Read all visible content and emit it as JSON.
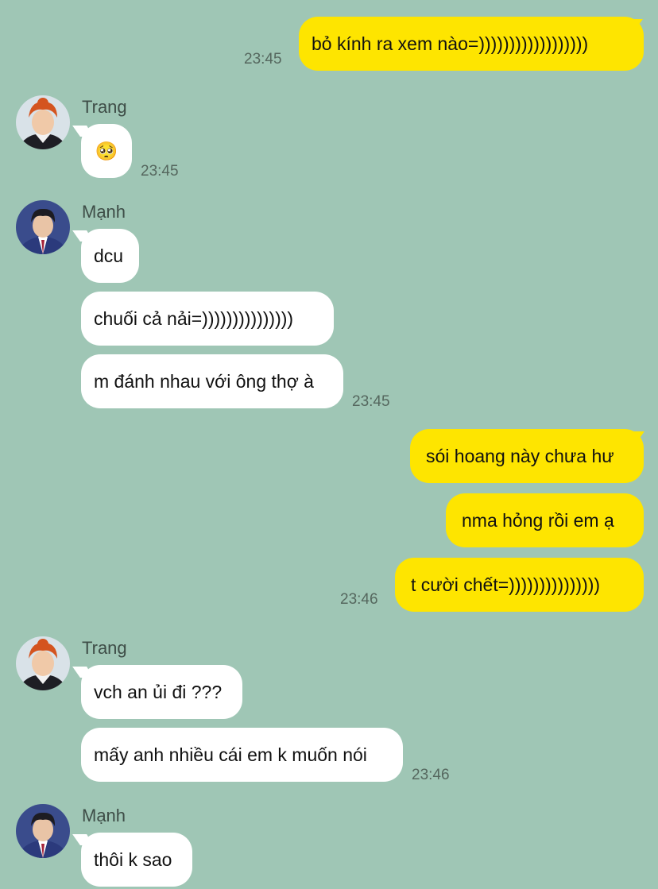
{
  "colors": {
    "background": "#9fc6b5",
    "incoming_bubble": "#ffffff",
    "outgoing_bubble": "#fee500"
  },
  "messages": {
    "m1": {
      "text": "bỏ kính ra xem nào=))))))))))))))))))",
      "time": "23:45"
    },
    "g1": {
      "sender": "Trang",
      "text": "🥺",
      "time": "23:45"
    },
    "g2": {
      "sender": "Mạnh",
      "m1": "dcu",
      "m2": "chuối cả nải=)))))))))))))))",
      "m3": "m đánh nhau với ông thợ à",
      "time": "23:45"
    },
    "g3": {
      "m1": "sói hoang này chưa hư",
      "m2": "nma hỏng rồi em ạ",
      "m3": "t cười chết=)))))))))))))))",
      "time": "23:46"
    },
    "g4": {
      "sender": "Trang",
      "m1": "vch an ủi đi ???",
      "m2": "mấy anh nhiều cái em k muốn nói",
      "time": "23:46"
    },
    "g5": {
      "sender": "Mạnh",
      "m1": "thôi k sao"
    }
  }
}
